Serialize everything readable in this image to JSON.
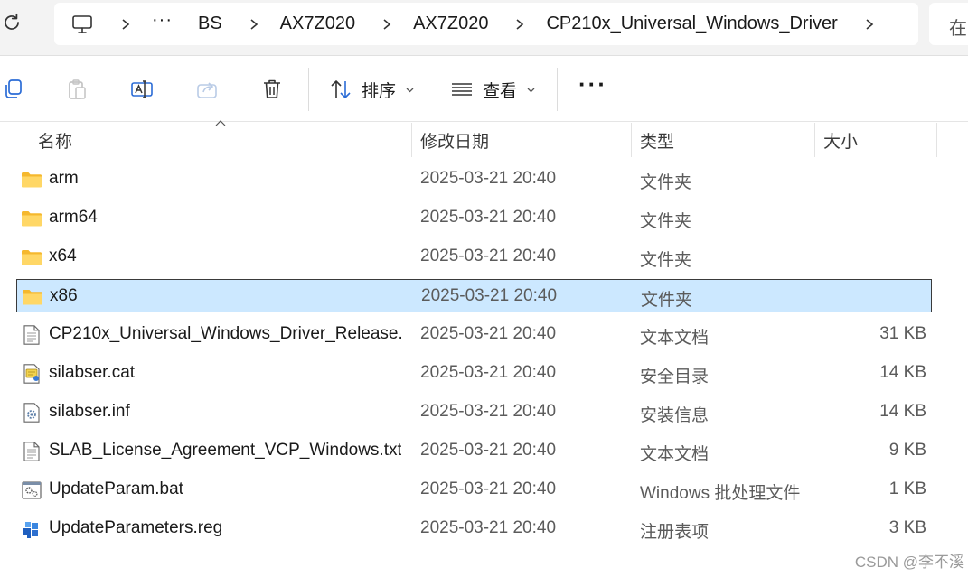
{
  "breadcrumb": {
    "items": [
      "BS",
      "AX7Z020",
      "AX7Z020",
      "CP210x_Universal_Windows_Driver"
    ],
    "overflow_label": "···",
    "search_label": "在"
  },
  "toolbar": {
    "sort_label": "排序",
    "view_label": "查看",
    "more_label": "···"
  },
  "columns": {
    "name": "名称",
    "date": "修改日期",
    "type": "类型",
    "size": "大小"
  },
  "files": [
    {
      "name": "arm",
      "date": "2025-03-21 20:40",
      "type": "文件夹",
      "size": "",
      "icon": "folder-icon"
    },
    {
      "name": "arm64",
      "date": "2025-03-21 20:40",
      "type": "文件夹",
      "size": "",
      "icon": "folder-icon"
    },
    {
      "name": "x64",
      "date": "2025-03-21 20:40",
      "type": "文件夹",
      "size": "",
      "icon": "folder-icon"
    },
    {
      "name": "x86",
      "date": "2025-03-21 20:40",
      "type": "文件夹",
      "size": "",
      "icon": "folder-icon",
      "selected": true
    },
    {
      "name": "CP210x_Universal_Windows_Driver_Release...",
      "date": "2025-03-21 20:40",
      "type": "文本文档",
      "size": "31 KB",
      "icon": "text-file-icon"
    },
    {
      "name": "silabser.cat",
      "date": "2025-03-21 20:40",
      "type": "安全目录",
      "size": "14 KB",
      "icon": "security-catalog-icon"
    },
    {
      "name": "silabser.inf",
      "date": "2025-03-21 20:40",
      "type": "安装信息",
      "size": "14 KB",
      "icon": "setup-info-icon"
    },
    {
      "name": "SLAB_License_Agreement_VCP_Windows.txt",
      "date": "2025-03-21 20:40",
      "type": "文本文档",
      "size": "9 KB",
      "icon": "text-file-icon"
    },
    {
      "name": "UpdateParam.bat",
      "date": "2025-03-21 20:40",
      "type": "Windows 批处理文件",
      "size": "1 KB",
      "icon": "batch-file-icon"
    },
    {
      "name": "UpdateParameters.reg",
      "date": "2025-03-21 20:40",
      "type": "注册表项",
      "size": "3 KB",
      "icon": "registry-file-icon"
    }
  ],
  "watermark": "CSDN @李不溪",
  "colors": {
    "selection_bg": "#cce8ff",
    "folder_yellow": "#f8c33a",
    "accent_blue": "#2b6cd6"
  }
}
